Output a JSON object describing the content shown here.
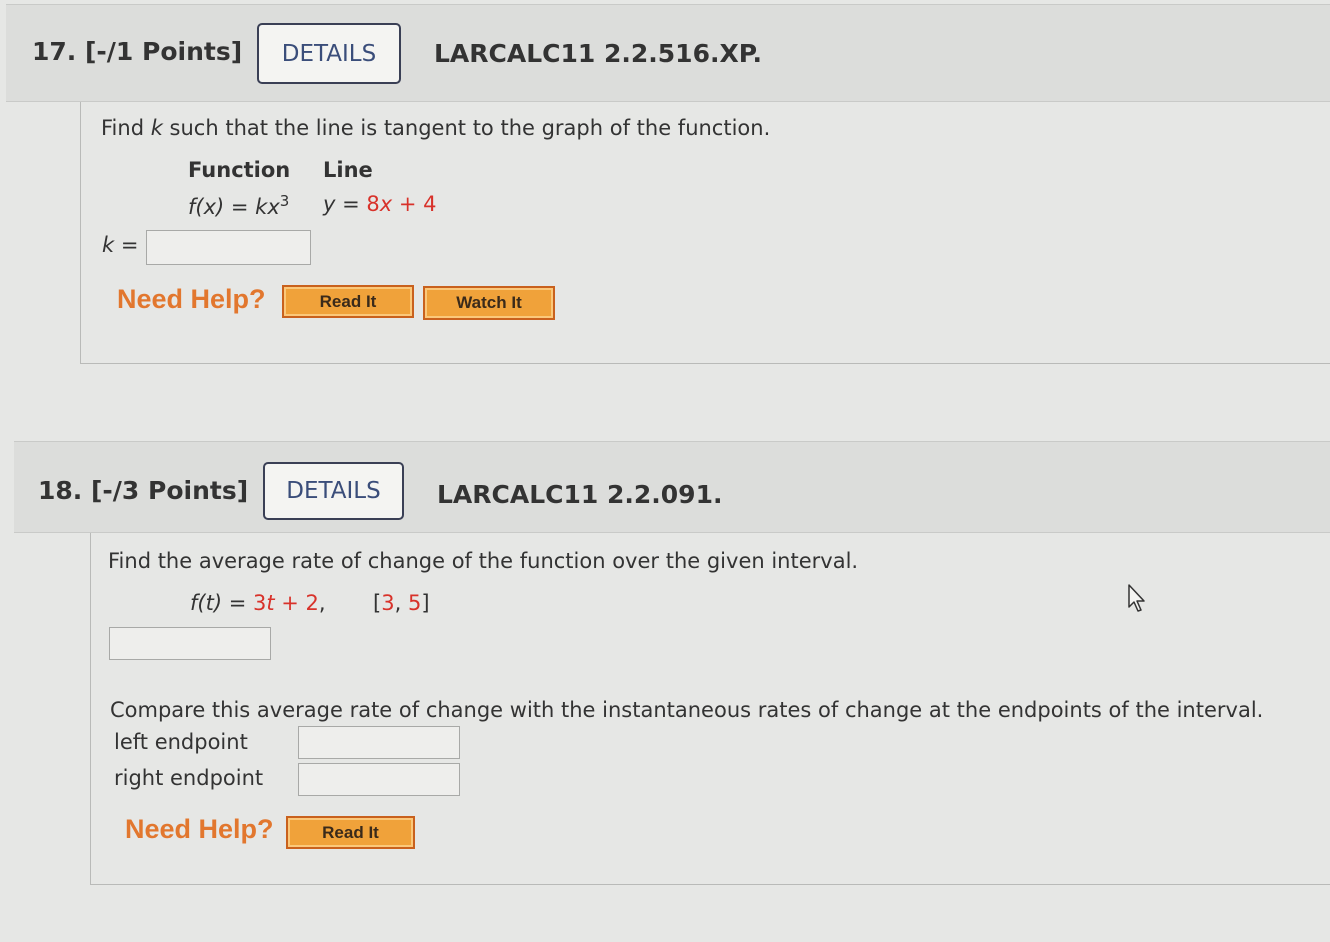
{
  "q17": {
    "title": "17.  [-/1 Points]",
    "details_label": "DETAILS",
    "code": "LARCALC11 2.2.516.XP.",
    "prompt_pre": "Find ",
    "prompt_var": "k",
    "prompt_post": " such that the line is tangent to the graph of the function.",
    "col_function": "Function",
    "col_line": "Line",
    "function_expr": "f(x) = kx",
    "function_exp": "3",
    "line_pre": "y = ",
    "line_coef": "8",
    "line_mid": "x + ",
    "line_const": "4",
    "answer_label": "k =",
    "need_help": "Need Help?",
    "read_it": "Read It",
    "watch_it": "Watch It"
  },
  "q18": {
    "title": "18.  [-/3 Points]",
    "details_label": "DETAILS",
    "code": "LARCALC11 2.2.091.",
    "prompt": "Find the average rate of change of the function over the given interval.",
    "func_pre": "f(t) = ",
    "func_coef": "3",
    "func_mid": "t + ",
    "func_const": "2",
    "func_comma": ",",
    "interval_open": "[",
    "interval_a": "3",
    "interval_sep": ", ",
    "interval_b": "5",
    "interval_close": "]",
    "compare_text": "Compare this average rate of change with the instantaneous rates of change at the endpoints of the interval.",
    "left_label": "left endpoint",
    "right_label": "right endpoint",
    "need_help": "Need Help?",
    "read_it": "Read It"
  },
  "colors": {
    "accent_red": "#d8322a",
    "help_orange": "#e2772e",
    "button_orange": "#f0a23a"
  }
}
